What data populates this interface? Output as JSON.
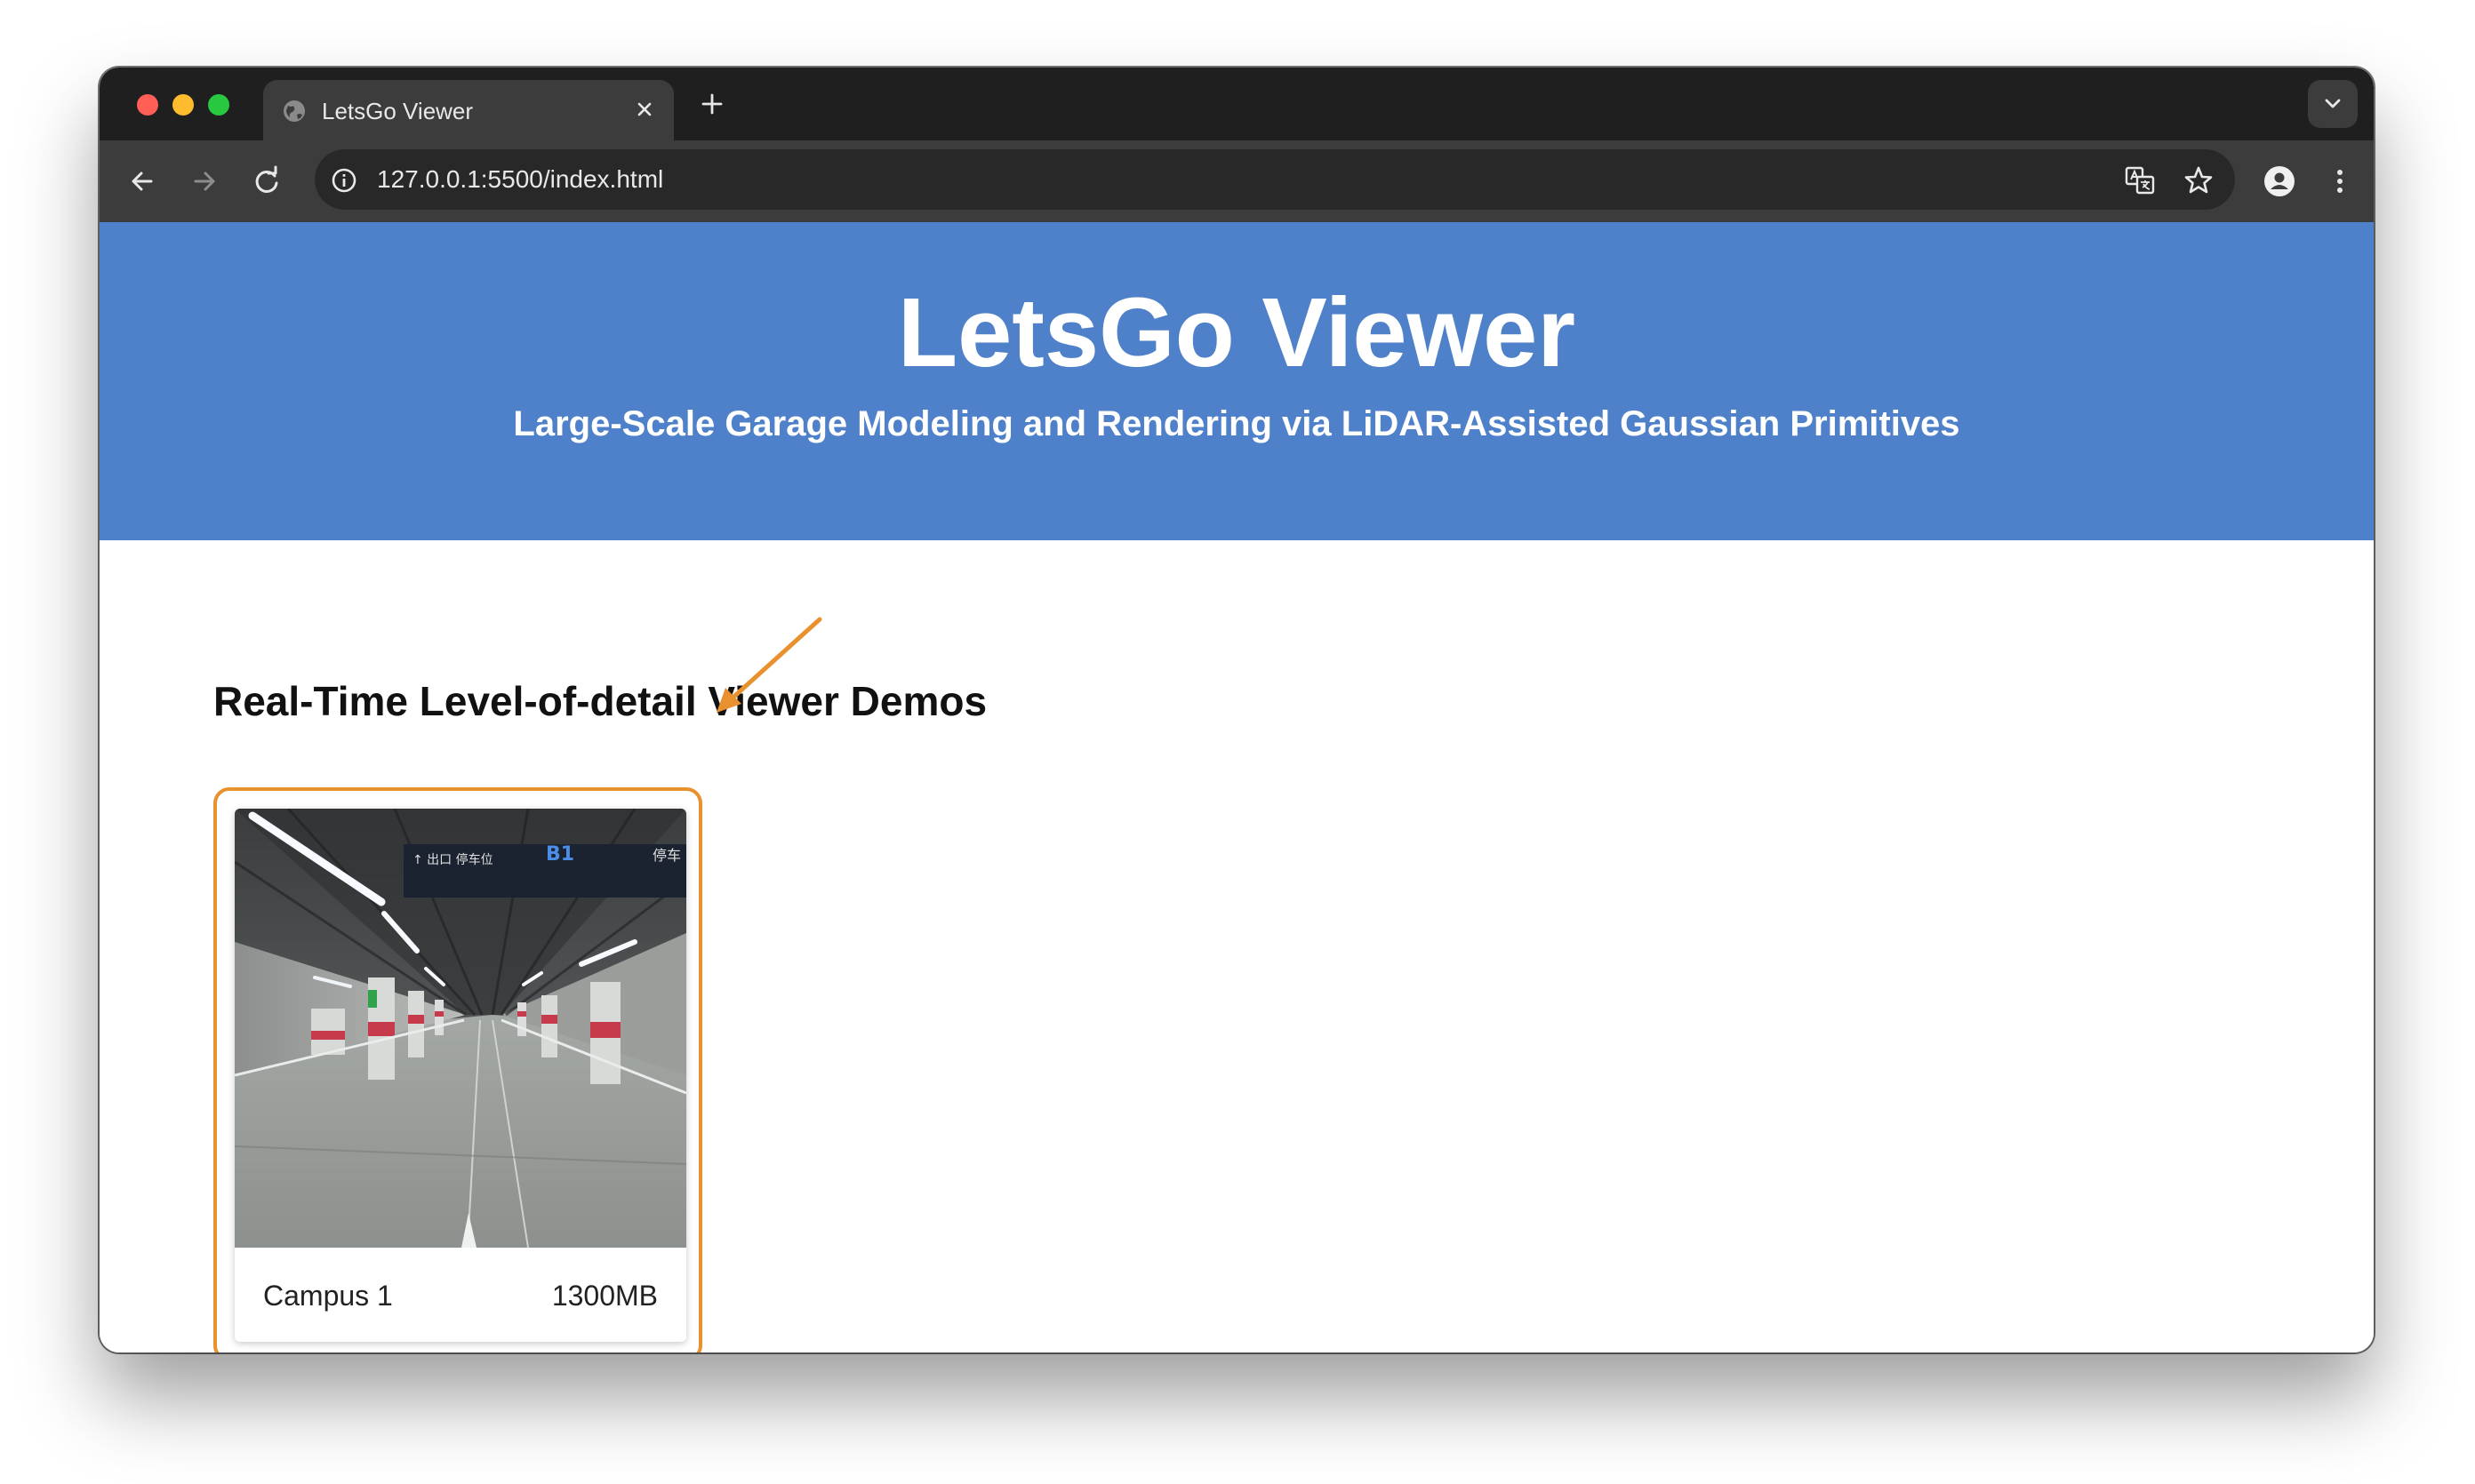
{
  "browser": {
    "tab_title": "LetsGo Viewer",
    "url": "127.0.0.1:5500/index.html",
    "icons": {
      "tab": "globe-icon",
      "close": "close-icon",
      "new_tab": "plus-icon",
      "tab_search": "chevron-down-icon",
      "back": "arrow-left-icon",
      "forward": "arrow-right-icon",
      "reload": "reload-icon",
      "site_info": "info-icon",
      "translate": "translate-icon",
      "bookmark": "star-icon",
      "profile": "person-icon",
      "menu": "kebab-menu-icon"
    }
  },
  "header": {
    "title": "LetsGo Viewer",
    "subtitle": "Large-Scale Garage Modeling and Rendering via LiDAR-Assisted Gaussian Primitives"
  },
  "main": {
    "section_title": "Real-Time Level-of-detail Viewer Demos",
    "demos": [
      {
        "name": "Campus 1",
        "size": "1300MB",
        "thumbnail": "underground-garage-photo"
      }
    ]
  },
  "colors": {
    "header_bg": "#4e81c9",
    "highlight": "#e8912e",
    "chrome_dark": "#1f1f1f",
    "chrome_toolbar": "#3c3c3c"
  }
}
